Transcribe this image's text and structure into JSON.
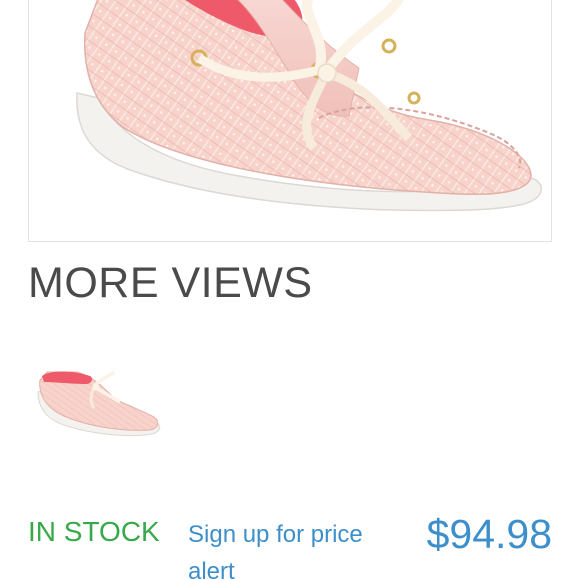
{
  "product": {
    "main_image_alt": "pink glitter boat shoe",
    "thumbnail_alt": "pink glitter boat shoe thumbnail"
  },
  "more_views": {
    "title": "MORE VIEWS"
  },
  "purchase": {
    "stock_status": "IN STOCK",
    "price_alert_label": "Sign up for price alert",
    "price": "$94.98"
  },
  "colors": {
    "stock_green": "#36a94b",
    "link_blue": "#3d8fcb",
    "title_gray": "#4a4a4a",
    "shoe_pink": "#f6cfc9",
    "lining_coral": "#ee5a6a"
  }
}
